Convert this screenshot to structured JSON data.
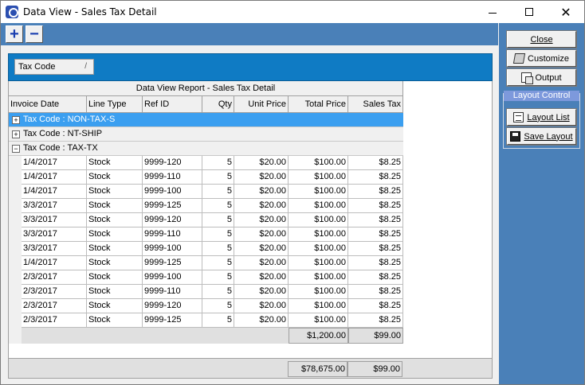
{
  "window": {
    "title": "Data View - Sales Tax Detail",
    "controls": {
      "minimize": "—",
      "maximize": "☐",
      "close": "✕"
    }
  },
  "toolbar": {
    "expand_label": "+",
    "collapse_label": "−"
  },
  "group_by": {
    "field": "Tax Code",
    "sort_indicator": "/"
  },
  "report": {
    "title": "Data View Report - Sales Tax Detail",
    "columns": [
      "Invoice Date",
      "Line Type",
      "Ref ID",
      "Qty",
      "Unit Price",
      "Total Price",
      "Sales Tax"
    ],
    "groups": [
      {
        "label": "Tax Code : NON-TAX-S",
        "expander": "+",
        "selected": true
      },
      {
        "label": "Tax Code : NT-SHIP",
        "expander": "+",
        "selected": false
      },
      {
        "label": "Tax Code : TAX-TX",
        "expander": "−",
        "selected": false
      }
    ],
    "rows": [
      [
        "1/4/2017",
        "Stock",
        "9999-120",
        "5",
        "$20.00",
        "$100.00",
        "$8.25"
      ],
      [
        "1/4/2017",
        "Stock",
        "9999-110",
        "5",
        "$20.00",
        "$100.00",
        "$8.25"
      ],
      [
        "1/4/2017",
        "Stock",
        "9999-100",
        "5",
        "$20.00",
        "$100.00",
        "$8.25"
      ],
      [
        "3/3/2017",
        "Stock",
        "9999-125",
        "5",
        "$20.00",
        "$100.00",
        "$8.25"
      ],
      [
        "3/3/2017",
        "Stock",
        "9999-120",
        "5",
        "$20.00",
        "$100.00",
        "$8.25"
      ],
      [
        "3/3/2017",
        "Stock",
        "9999-110",
        "5",
        "$20.00",
        "$100.00",
        "$8.25"
      ],
      [
        "3/3/2017",
        "Stock",
        "9999-100",
        "5",
        "$20.00",
        "$100.00",
        "$8.25"
      ],
      [
        "1/4/2017",
        "Stock",
        "9999-125",
        "5",
        "$20.00",
        "$100.00",
        "$8.25"
      ],
      [
        "2/3/2017",
        "Stock",
        "9999-100",
        "5",
        "$20.00",
        "$100.00",
        "$8.25"
      ],
      [
        "2/3/2017",
        "Stock",
        "9999-110",
        "5",
        "$20.00",
        "$100.00",
        "$8.25"
      ],
      [
        "2/3/2017",
        "Stock",
        "9999-120",
        "5",
        "$20.00",
        "$100.00",
        "$8.25"
      ],
      [
        "2/3/2017",
        "Stock",
        "9999-125",
        "5",
        "$20.00",
        "$100.00",
        "$8.25"
      ]
    ],
    "subtotal": {
      "total_price": "$1,200.00",
      "sales_tax": "$99.00"
    },
    "grand_total": {
      "total_price": "$78,675.00",
      "sales_tax": "$99.00"
    }
  },
  "side_panel": {
    "close_label": "Close",
    "customize_label": "Customize",
    "output_label": "Output",
    "layout_control_caption": "Layout Control",
    "layout_list_label": "Layout List",
    "save_layout_label": "Save Layout"
  },
  "colors": {
    "toolbar_blue": "#4a80b8",
    "group_panel_blue": "#0f7bc4",
    "selected_row": "#3b9ff0"
  }
}
